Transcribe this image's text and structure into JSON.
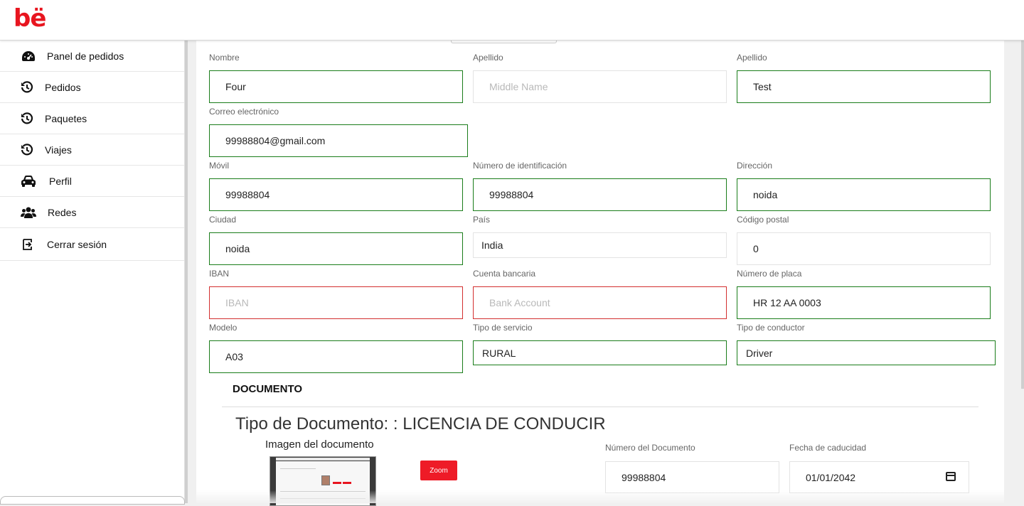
{
  "app": {
    "logo": "bë",
    "brand_color": "#e8151f"
  },
  "sidebar": {
    "items": [
      {
        "label": "Panel de pedidos",
        "icon": "dashboard-gauge-icon"
      },
      {
        "label": "Pedidos",
        "icon": "history-icon"
      },
      {
        "label": "Paquetes",
        "icon": "history-icon"
      },
      {
        "label": "Viajes",
        "icon": "history-icon"
      },
      {
        "label": "Perfil",
        "icon": "car-icon"
      },
      {
        "label": "Redes",
        "icon": "users-icon"
      },
      {
        "label": "Cerrar sesión",
        "icon": "sign-out-icon"
      }
    ]
  },
  "form": {
    "nombre": {
      "label": "Nombre",
      "value": "Four"
    },
    "middle": {
      "label": "Apellido",
      "placeholder": "Middle Name"
    },
    "apellido": {
      "label": "Apellido",
      "value": "Test"
    },
    "correo": {
      "label": "Correo electrónico",
      "value": "99988804@gmail.com"
    },
    "movil": {
      "label": "Móvil",
      "value": "99988804"
    },
    "identificacion": {
      "label": "Número de identificación",
      "value": "99988804"
    },
    "direccion": {
      "label": "Dirección",
      "value": "noida"
    },
    "ciudad": {
      "label": "Ciudad",
      "value": "noida"
    },
    "pais": {
      "label": "País",
      "value": "India"
    },
    "codigo_postal": {
      "label": "Código postal",
      "value": "0"
    },
    "iban": {
      "label": "IBAN",
      "placeholder": "IBAN"
    },
    "cuenta": {
      "label": "Cuenta bancaria",
      "placeholder": "Bank Account"
    },
    "placa": {
      "label": "Número de placa",
      "value": "HR 12 AA 0003"
    },
    "modelo": {
      "label": "Modelo",
      "value": "A03"
    },
    "tipo_servicio": {
      "label": "Tipo de servicio",
      "value": "RURAL"
    },
    "tipo_conductor": {
      "label": "Tipo de conductor",
      "value": "Driver"
    }
  },
  "document": {
    "section_title": "DOCUMENTO",
    "type_title": "Tipo de Documento: : LICENCIA DE CONDUCIR",
    "image_label": "Imagen del documento",
    "zoom_label": "Zoom",
    "numero": {
      "label": "Número del Documento",
      "value": "99988804"
    },
    "caducidad": {
      "label": "Fecha de caducidad",
      "value": "01/01/2042"
    }
  }
}
